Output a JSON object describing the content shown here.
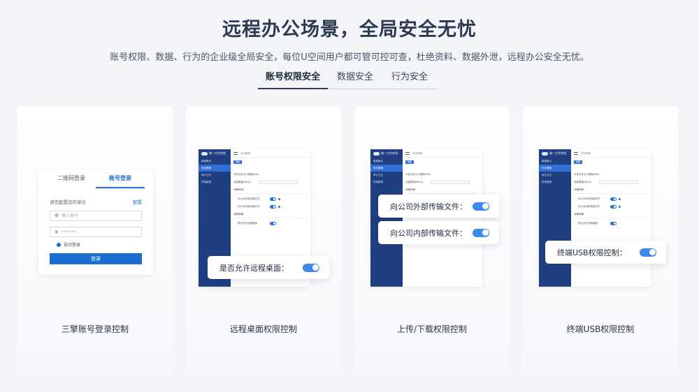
{
  "header": {
    "title": "远程办公场景，全局安全无忧",
    "subtitle": "账号权限、数据、行为的企业级全局安全，每位U空间用户都可管可控可查，杜绝资料、数据外泄，远程办公安全无忧。"
  },
  "tabs": [
    {
      "label": "账号权限安全",
      "active": true
    },
    {
      "label": "数据安全",
      "active": false
    },
    {
      "label": "行为安全",
      "active": false
    }
  ],
  "cards": [
    {
      "caption": "三擎账号登录控制",
      "login": {
        "tab_qr": "二维码登录",
        "tab_account": "账号登录",
        "unit_prompt": "请先配置您的单位",
        "config_link": "配置",
        "account_placeholder": "输入账号",
        "password_mask": "••••••",
        "auto_login": "自动登录",
        "submit": "登录"
      }
    },
    {
      "caption": "远程桌面权限控制",
      "float": [
        "是否允许远程桌面："
      ]
    },
    {
      "caption": "上传/下载权限控制",
      "float": [
        "向公司外部传输文件：",
        "向公司内部传输文件："
      ]
    },
    {
      "caption": "终端USB权限控制",
      "float": [
        "终端USB权限控制："
      ]
    }
  ],
  "mock": {
    "logo": "统一工作空间",
    "menu": [
      "数据概况",
      "安全策略",
      "审计日志",
      "终端管理"
    ],
    "breadcrumb": "安全策略",
    "badge": "策略",
    "rows": [
      "外发文件大小限制(MB)",
      "流量限速(Mb/s)"
    ],
    "sec_transfer": "传输控制",
    "row_out": "向公司外部传输文件",
    "row_in": "向公司内部传输文件",
    "sec_remote": "远程桌面",
    "row_remote": "是否允许远程桌面"
  },
  "colors": {
    "accent": "#3d8ae8",
    "sidebar": "#1f3f80",
    "primary": "#1c6fd1"
  }
}
